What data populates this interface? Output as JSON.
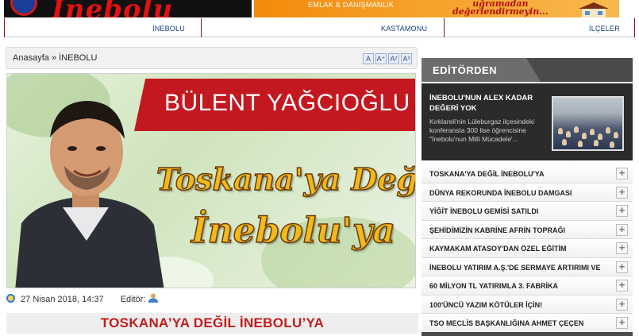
{
  "header": {
    "logo_text": "İnebolu",
    "ad_left_text": "EMLAK & DANIŞMANLIK",
    "ad_right_line1": "uğramadan",
    "ad_right_line2": "değerlendirmeyin..."
  },
  "nav": {
    "items": [
      "İNEBOLU",
      "KASTAMONU",
      "İLÇELER"
    ]
  },
  "breadcrumb": {
    "home": "Anasayfa",
    "separator": "»",
    "current": "İNEBOLU"
  },
  "font_buttons": [
    "A",
    "A⁺",
    "A²",
    "A³"
  ],
  "hero": {
    "author_name": "BÜLENT YAĞCIOĞLU",
    "headline_line1": "Toskana'ya Değil",
    "headline_line2": "İnebolu'ya"
  },
  "article": {
    "date": "27 Nisan 2018, 14:37",
    "editor_label": "Editör:",
    "title": "TOSKANA’YA DEĞİL İNEBOLU’YA"
  },
  "sidebar": {
    "section_title": "EDİTÖRDEN",
    "featured": {
      "title": "İNEBOLU'NUN ALEX KADAR DEĞERİ YOK",
      "description": "Kırklareli'nin Lüleburgaz ilçesindeki konferansta 300 lise öğrencisine \"İnebolu'nun Milli Mücadele'..."
    },
    "news": [
      "TOSKANA'YA DEĞİL İNEBOLU'YA",
      "DÜNYA REKORUNDA İNEBOLU DAMGASI",
      "YİĞİT İNEBOLU GEMİSİ SATILDI",
      "ŞEHİDİMİZİN KABRİNE AFRİN TOPRAĞI",
      "KAYMAKAM ATASOY'DAN ÖZEL EĞİTİM",
      "İNEBOLU YATIRIM A.Ş.'DE SERMAYE ARTIRIMI VE",
      "60 MİLYON TL YATIRIMLA 3. FABRİKA",
      "100'ÜNCÜ YAZIM KÖTÜLER İÇİN!",
      "TSO MECLİS BAŞKANLIĞINA AHMET ÇEÇEN"
    ],
    "expand_symbol": "+"
  },
  "colors": {
    "nav_separator": "#8b0f14",
    "nav_text": "#1b3e84",
    "title_red": "#c31c1c",
    "banner_red": "#c41820",
    "sidebar_dark": "#2b2b2b"
  }
}
